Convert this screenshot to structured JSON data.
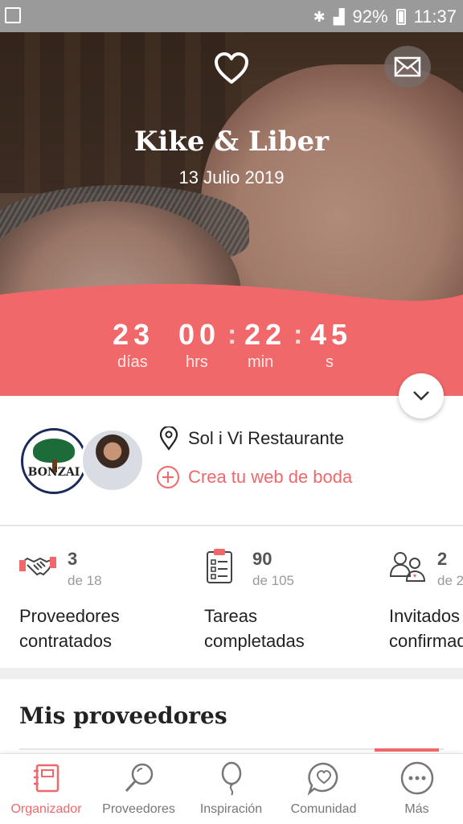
{
  "status_bar": {
    "battery": "92%",
    "time": "11:37"
  },
  "hero": {
    "couple_names": "Kike & Liber",
    "wedding_date": "13 Julio 2019",
    "heart_icon": "heart-outline-icon",
    "mail_icon": "mail-icon"
  },
  "countdown": {
    "days": "23",
    "hours": "00",
    "minutes": "22",
    "seconds": "45",
    "days_label": "días",
    "hours_label": "hrs",
    "minutes_label": "min",
    "seconds_label": "s"
  },
  "profile": {
    "avatar1_text": "BONZAI",
    "venue": "Sol i Vi Restaurante",
    "cta": "Crea tu web de boda"
  },
  "stats": [
    {
      "icon": "handshake-icon",
      "count": "3",
      "total": "de 18",
      "label_line1": "Proveedores",
      "label_line2": "contratados"
    },
    {
      "icon": "clipboard-icon",
      "count": "90",
      "total": "de 105",
      "label_line1": "Tareas",
      "label_line2": "completadas"
    },
    {
      "icon": "guests-icon",
      "count": "2",
      "total": "de 2",
      "label_line1": "Invitados",
      "label_line2": "confirmados"
    }
  ],
  "section_title": "Mis proveedores",
  "nav": [
    {
      "label": "Organizador",
      "icon": "notebook-icon",
      "active": true
    },
    {
      "label": "Proveedores",
      "icon": "search-icon",
      "active": false
    },
    {
      "label": "Inspiración",
      "icon": "balloon-icon",
      "active": false
    },
    {
      "label": "Comunidad",
      "icon": "chat-heart-icon",
      "active": false
    },
    {
      "label": "Más",
      "icon": "more-icon",
      "active": false
    }
  ],
  "colors": {
    "accent": "#f0686a",
    "text": "#222222",
    "muted": "#9a9a9a"
  }
}
